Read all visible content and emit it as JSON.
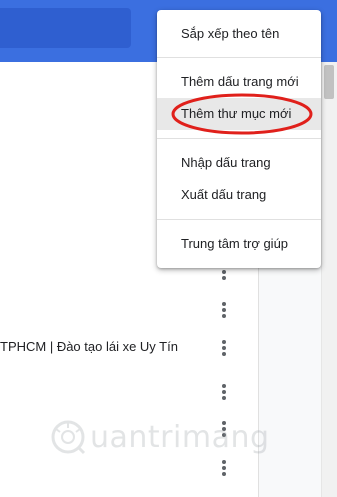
{
  "bookmark_row": {
    "title": "TPHCM | Đào tạo lái xe Uy Tín"
  },
  "menu": {
    "items": [
      {
        "label": "Sắp xếp theo tên"
      },
      {
        "label": "Thêm dấu trang mới"
      },
      {
        "label": "Thêm thư mục mới"
      },
      {
        "label": "Nhập dấu trang"
      },
      {
        "label": "Xuất dấu trang"
      },
      {
        "label": "Trung tâm trợ giúp"
      }
    ]
  },
  "watermark": {
    "text": "uantrimang"
  },
  "colors": {
    "header": "#3b6fe0",
    "highlight": "#e0201b"
  }
}
